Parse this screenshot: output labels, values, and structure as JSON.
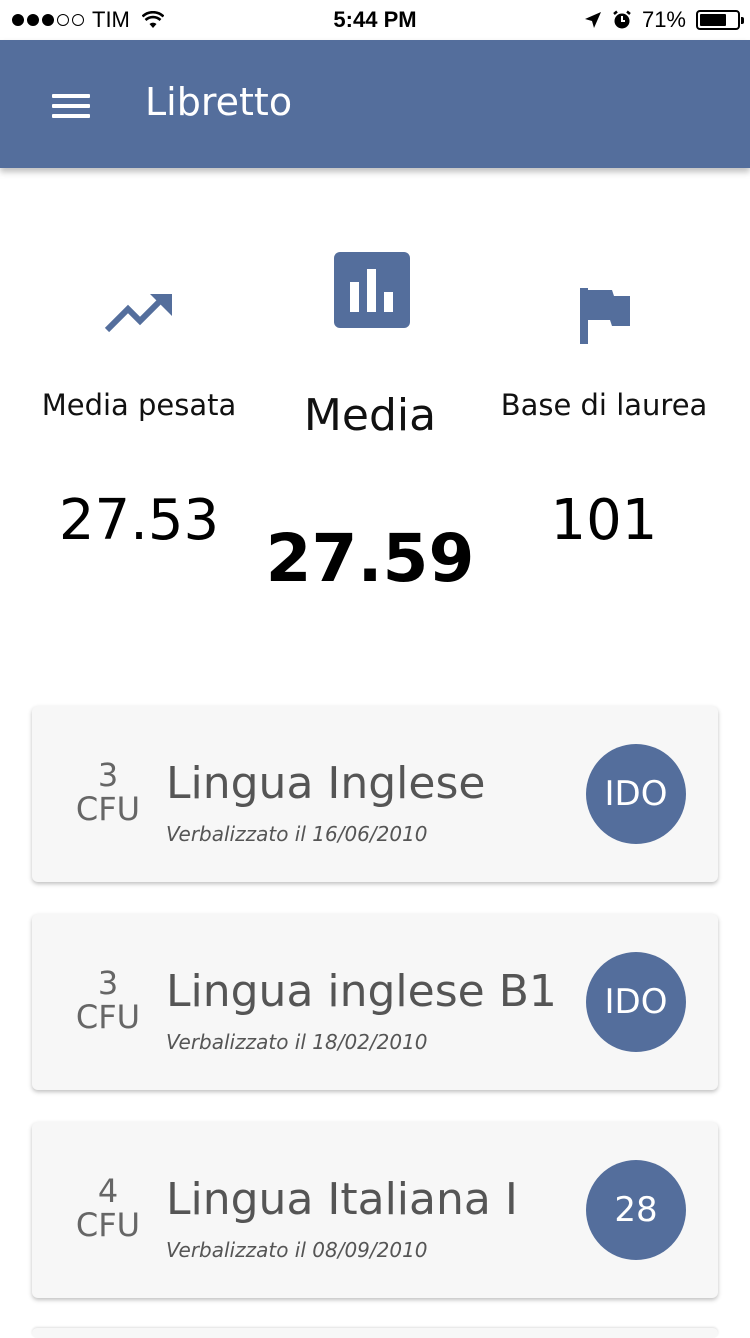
{
  "status_bar": {
    "carrier": "TIM",
    "time": "5:44 PM",
    "battery_percent": "71%",
    "battery_level": 0.71,
    "signal_bars_filled": 3,
    "signal_bars_total": 5
  },
  "app_bar": {
    "title": "Libretto",
    "menu_icon": "hamburger-menu-icon",
    "color": "#546e9c"
  },
  "stats": {
    "weighted_average": {
      "label": "Media pesata",
      "value": "27.53",
      "icon": "trending-up-icon"
    },
    "average": {
      "label": "Media",
      "value": "27.59",
      "icon": "bar-chart-icon"
    },
    "graduation_base": {
      "label": "Base di laurea",
      "value": "101",
      "icon": "flag-icon"
    }
  },
  "exams": [
    {
      "cfu_number": "3",
      "cfu_unit": "CFU",
      "name": "Lingua Inglese",
      "date": "Verbalizzato il 16/06/2010",
      "grade": "IDO"
    },
    {
      "cfu_number": "3",
      "cfu_unit": "CFU",
      "name": "Lingua inglese B1",
      "date": "Verbalizzato il 18/02/2010",
      "grade": "IDO"
    },
    {
      "cfu_number": "4",
      "cfu_unit": "CFU",
      "name": "Lingua Italiana I",
      "date": "Verbalizzato il 08/09/2010",
      "grade": "28"
    }
  ]
}
